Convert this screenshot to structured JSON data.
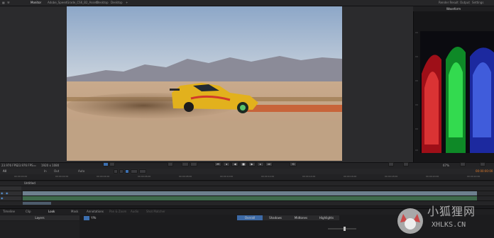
{
  "topbar": {
    "tabs": [
      "Monitor",
      "Adobe_SpeedGrade_CS6_B2_Assets",
      "Desktop",
      "Desktop",
      "+"
    ],
    "right_items": [
      "Render Result",
      "Output",
      "Settings"
    ]
  },
  "scopes": {
    "title": "Waveform"
  },
  "status": {
    "fps": "23.976 FPS",
    "fps2": "23.976 FPS",
    "resolution": "1920 x 1080",
    "zoom": "67%"
  },
  "timeline": {
    "ruler_labels": [
      "00:00:00:00",
      "00:00:02:00",
      "00:00:04:00",
      "00:00:06:00",
      "00:00:08:00",
      "00:00:10:00",
      "00:00:12:00",
      "00:00:14:00",
      "00:00:16:00",
      "00:00:18:00",
      "00:00:20:00",
      "00:00:22:00"
    ],
    "timecode": "00:00:00:00",
    "sequence_label": "Untitled",
    "auto_label": "Auto",
    "in_label": "In",
    "out_label": "Out"
  },
  "bottom": {
    "tabs": [
      "Timeline",
      "Clip",
      "Look",
      "Mask",
      "Annotations",
      "Pan & Zoom",
      "Audio",
      "Shot Matcher"
    ],
    "layers_label": "Layers",
    "fps_label": "YPb",
    "subtabs": [
      "Overall",
      "Shadows",
      "Midtones",
      "Highlights"
    ],
    "active_subtab": "Overall",
    "colors": {
      "accent": "#3d6aa6",
      "bg": "#1b1b1d"
    }
  },
  "watermark": {
    "brand_cn": "小狐狸网",
    "brand_latin": "XHLKS.CN"
  }
}
